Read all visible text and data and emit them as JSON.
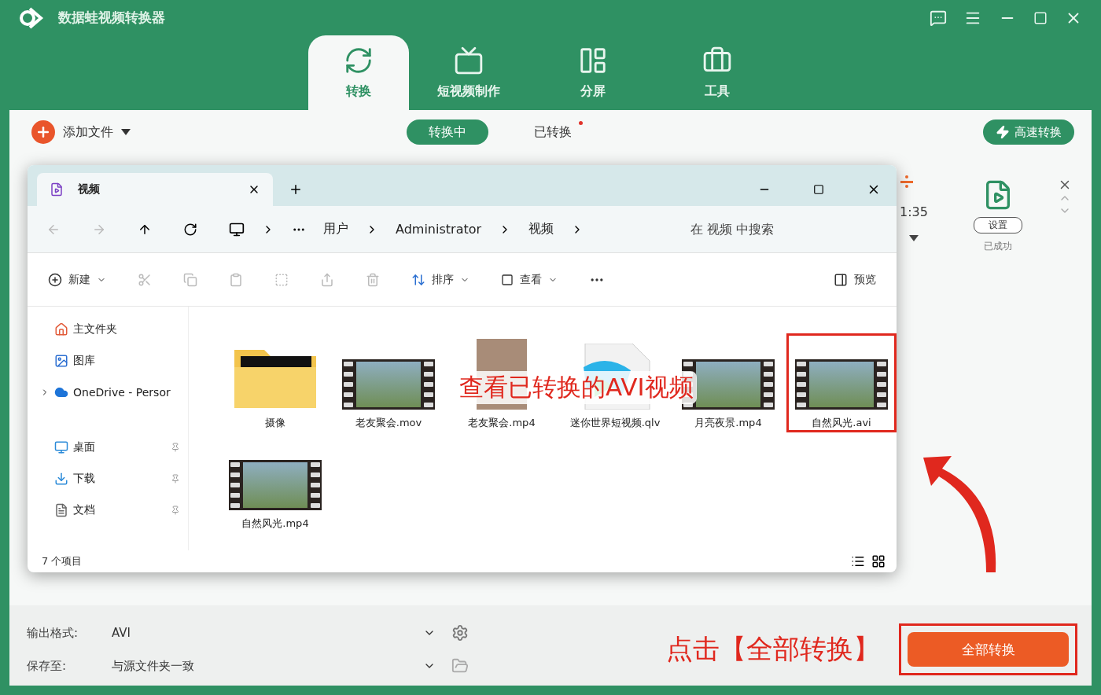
{
  "app": {
    "title": "数据蛙视频转换器"
  },
  "nav_tabs": [
    {
      "label": "转换",
      "selected": true
    },
    {
      "label": "短视频制作",
      "selected": false
    },
    {
      "label": "分屏",
      "selected": false
    },
    {
      "label": "工具",
      "selected": false
    }
  ],
  "toolbar": {
    "add_files": "添加文件",
    "sub_tabs": [
      {
        "label": "转换中",
        "selected": true,
        "unread": false
      },
      {
        "label": "已转换",
        "selected": false,
        "unread": true
      }
    ],
    "fast_convert": "高速转换"
  },
  "task_panel": {
    "time": "1:35",
    "settings": "设置",
    "status": "已成功"
  },
  "explorer": {
    "tab_title": "视频",
    "breadcrumb": [
      "用户",
      "Administrator",
      "视频"
    ],
    "search": {
      "placeholder": "在 视频 中搜索"
    },
    "commands": {
      "new": "新建",
      "sort": "排序",
      "view": "查看",
      "preview": "预览"
    },
    "sidebar": [
      {
        "label": "主文件夹",
        "expandable": false,
        "pinned": false
      },
      {
        "label": "图库",
        "expandable": false,
        "pinned": false
      },
      {
        "label": "OneDrive - Persor",
        "expandable": true,
        "pinned": false
      },
      {
        "label": "桌面",
        "expandable": false,
        "pinned": true
      },
      {
        "label": "下载",
        "expandable": false,
        "pinned": true
      },
      {
        "label": "文档",
        "expandable": false,
        "pinned": true
      }
    ],
    "files": [
      {
        "name": "摄像",
        "kind": "folder",
        "annotated": false
      },
      {
        "name": "老友聚会.mov",
        "kind": "film",
        "annotated": false
      },
      {
        "name": "老友聚会.mp4",
        "kind": "photo",
        "annotated": false
      },
      {
        "name": "迷你世界短视频.qlv",
        "kind": "document",
        "annotated": false
      },
      {
        "name": "月亮夜景.mp4",
        "kind": "film",
        "annotated": false
      },
      {
        "name": "自然风光.avi",
        "kind": "film",
        "annotated": true
      },
      {
        "name": "自然风光.mp4",
        "kind": "film",
        "annotated": false
      }
    ],
    "status": "7 个项目"
  },
  "bottom": {
    "output_format_label": "输出格式:",
    "output_format": "AVI",
    "save_to_label": "保存至:",
    "save_to": "与源文件夹一致",
    "convert_all": "全部转换",
    "convert_all_annotated": true
  },
  "annotations": [
    {
      "text": "查看已转换的AVI视频"
    },
    {
      "text": "点击【全部转换】"
    }
  ]
}
